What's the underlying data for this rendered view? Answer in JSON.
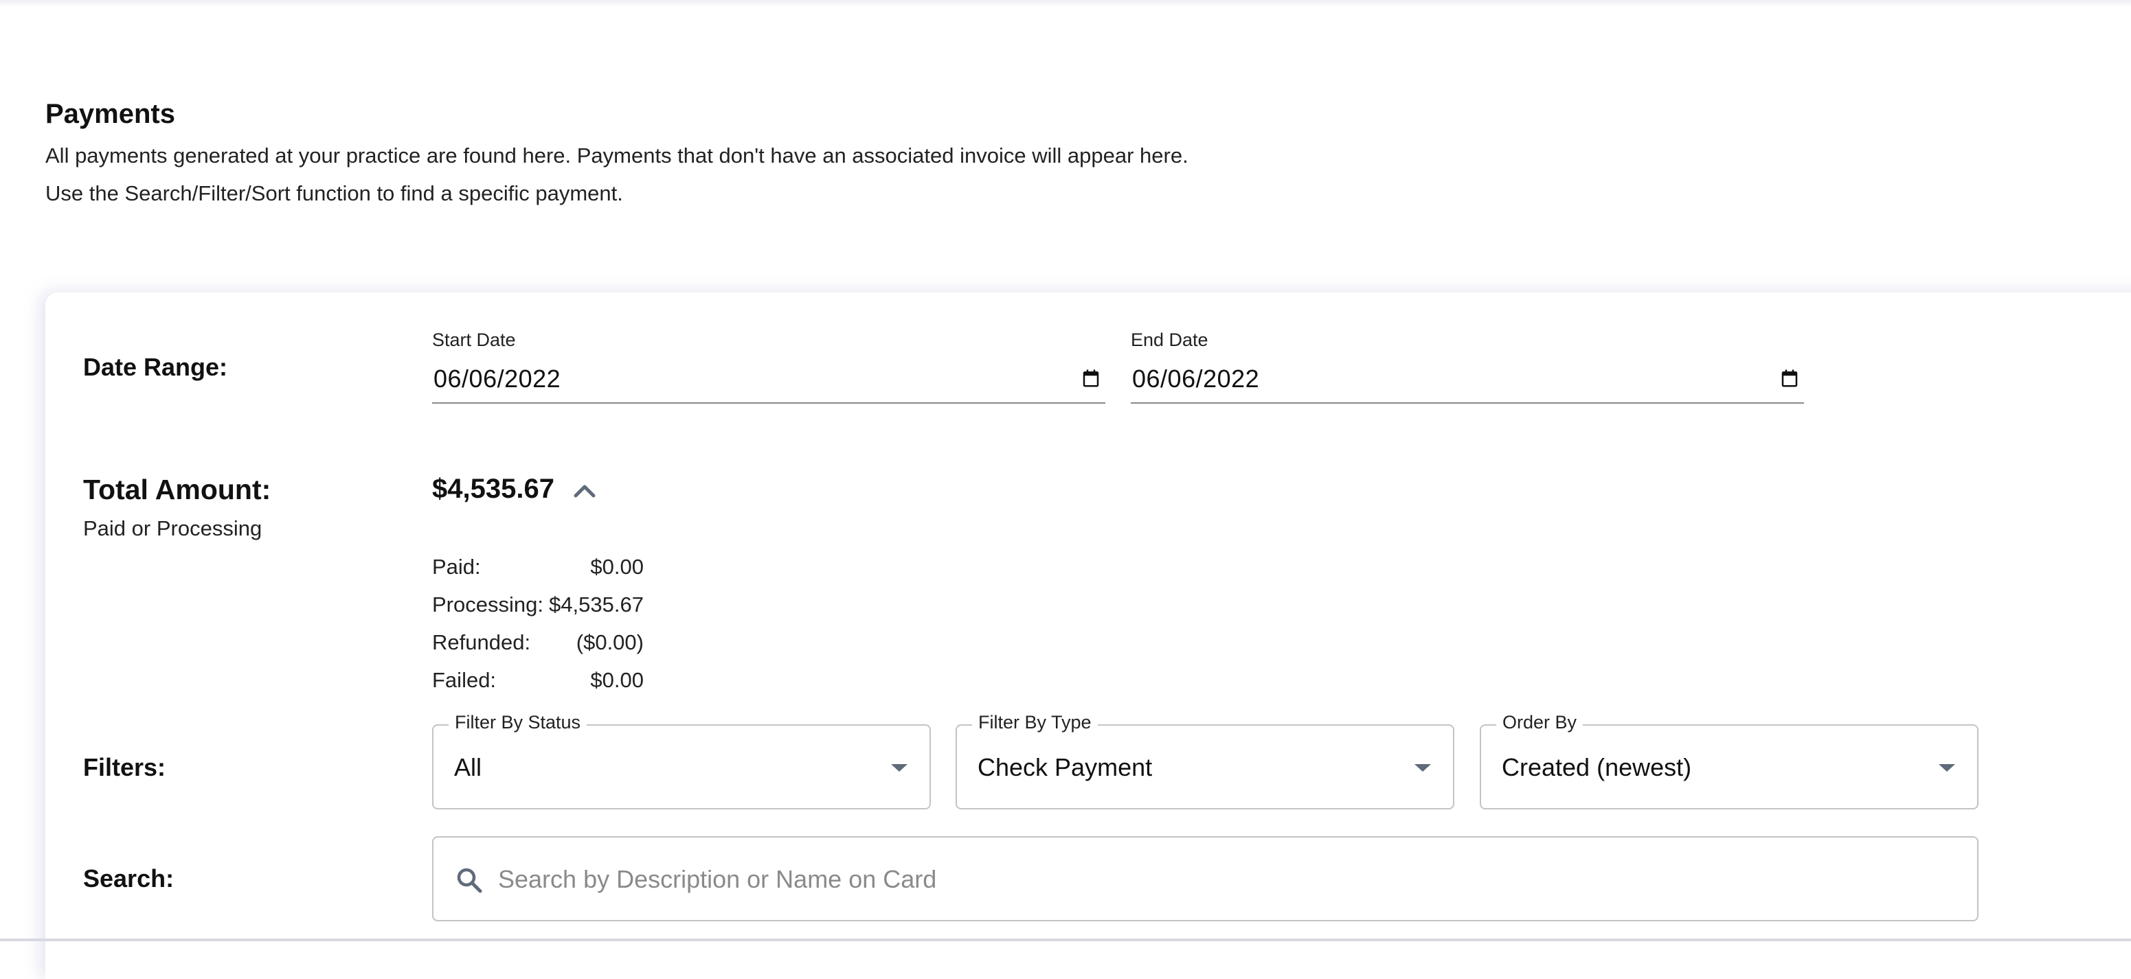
{
  "page": {
    "title": "Payments",
    "description_line1": "All payments generated at your practice are found here. Payments that don't have an associated invoice will appear here.",
    "description_line2": "Use the Search/Filter/Sort function to find a specific payment."
  },
  "date_range": {
    "label": "Date Range:",
    "start": {
      "label": "Start Date",
      "value": "06/06/2022",
      "icon": "calendar-icon"
    },
    "end": {
      "label": "End Date",
      "value": "06/06/2022",
      "icon": "calendar-icon"
    }
  },
  "total": {
    "label": "Total Amount:",
    "sublabel": "Paid or Processing",
    "amount": "$4,535.67",
    "toggle_icon": "chevron-up-icon",
    "breakdown": [
      {
        "label": "Paid:",
        "value": "$0.00"
      },
      {
        "label": "Processing:",
        "value": "$4,535.67"
      },
      {
        "label": "Refunded:",
        "value": "($0.00)"
      },
      {
        "label": "Failed:",
        "value": "$0.00"
      }
    ]
  },
  "filters": {
    "label": "Filters:",
    "status": {
      "label": "Filter By Status",
      "value": "All"
    },
    "type": {
      "label": "Filter By Type",
      "value": "Check Payment"
    },
    "order": {
      "label": "Order By",
      "value": "Created (newest)"
    }
  },
  "search": {
    "label": "Search:",
    "placeholder": "Search by Description or Name on Card",
    "value": "",
    "icon": "search-icon"
  },
  "colors": {
    "text": "#111111",
    "muted": "#8a8a8a",
    "border": "#c4c4c4",
    "icon": "#5f6b7a"
  }
}
